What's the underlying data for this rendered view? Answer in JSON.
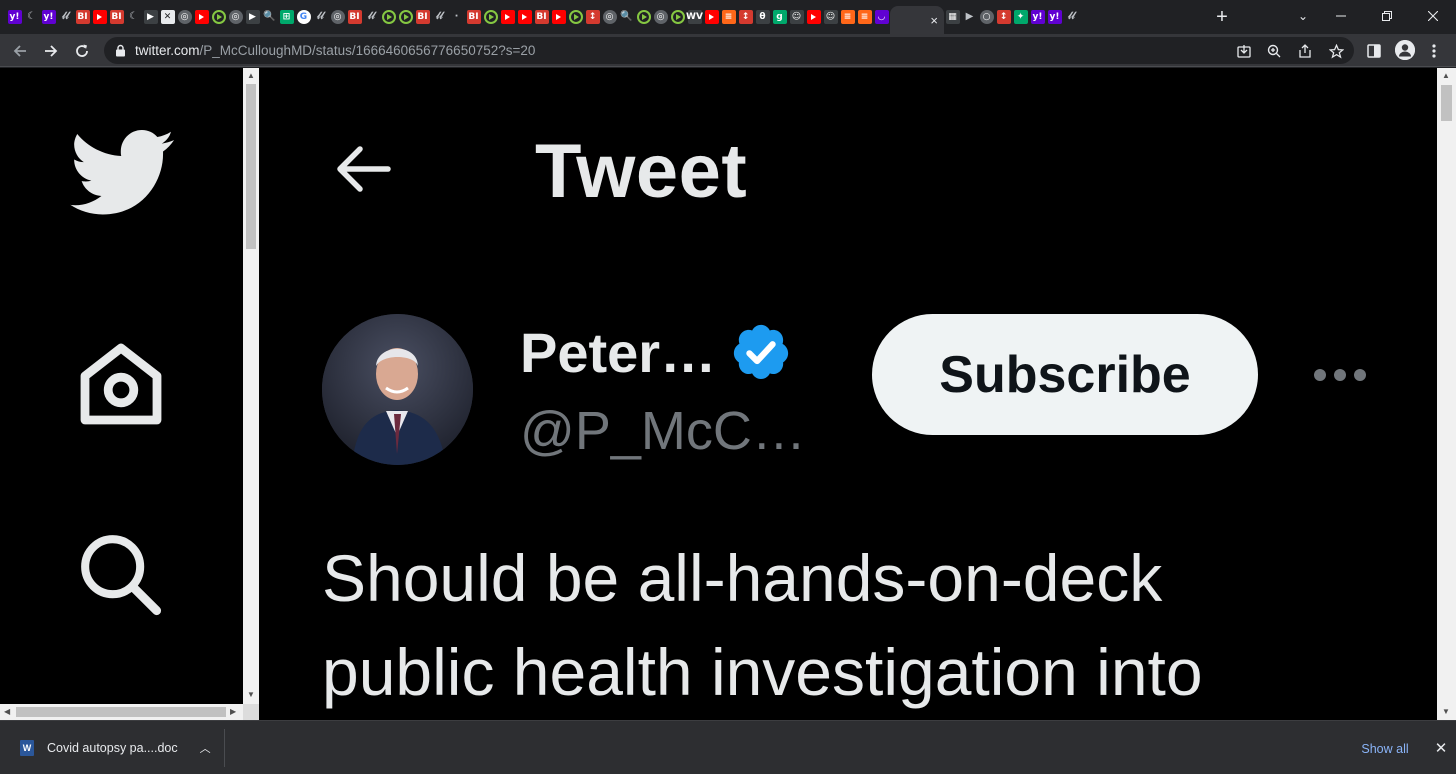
{
  "browser": {
    "tab_favicons": [
      {
        "kind": "yahoo",
        "glyph": "y!"
      },
      {
        "kind": "sub",
        "glyph": "☾"
      },
      {
        "kind": "yahoo",
        "glyph": "y!"
      },
      {
        "kind": "sub",
        "glyph": "𝓁𝓁"
      },
      {
        "kind": "bi",
        "glyph": "BI"
      },
      {
        "kind": "yt",
        "glyph": ""
      },
      {
        "kind": "bi",
        "glyph": "BI"
      },
      {
        "kind": "sub",
        "glyph": "☾"
      },
      {
        "kind": "dark",
        "glyph": "▶"
      },
      {
        "kind": "doc",
        "glyph": "✕"
      },
      {
        "kind": "globe",
        "glyph": "◎"
      },
      {
        "kind": "yt",
        "glyph": ""
      },
      {
        "kind": "rumble",
        "glyph": ""
      },
      {
        "kind": "globe",
        "glyph": "◎"
      },
      {
        "kind": "dark",
        "glyph": "▶"
      },
      {
        "kind": "sub",
        "glyph": "🔍"
      },
      {
        "kind": "green",
        "glyph": "⊞"
      },
      {
        "kind": "google",
        "glyph": "G"
      },
      {
        "kind": "sub",
        "glyph": "𝓁𝓁"
      },
      {
        "kind": "globe",
        "glyph": "◎"
      },
      {
        "kind": "bi",
        "glyph": "BI"
      },
      {
        "kind": "sub",
        "glyph": "𝓁𝓁"
      },
      {
        "kind": "rumble",
        "glyph": ""
      },
      {
        "kind": "rumble",
        "glyph": ""
      },
      {
        "kind": "bi",
        "glyph": "BI"
      },
      {
        "kind": "sub",
        "glyph": "𝓁𝓁"
      },
      {
        "kind": "sub",
        "glyph": "·"
      },
      {
        "kind": "bi",
        "glyph": "BI"
      },
      {
        "kind": "rumble",
        "glyph": ""
      },
      {
        "kind": "yt",
        "glyph": ""
      },
      {
        "kind": "yt",
        "glyph": ""
      },
      {
        "kind": "bi",
        "glyph": "BI"
      },
      {
        "kind": "yt",
        "glyph": ""
      },
      {
        "kind": "rumble",
        "glyph": ""
      },
      {
        "kind": "bi",
        "glyph": "↕"
      },
      {
        "kind": "globe",
        "glyph": "◎"
      },
      {
        "kind": "sub",
        "glyph": "🔍"
      },
      {
        "kind": "rumble",
        "glyph": ""
      },
      {
        "kind": "globe",
        "glyph": "◎"
      },
      {
        "kind": "rumble",
        "glyph": ""
      },
      {
        "kind": "dark",
        "glyph": "WV"
      },
      {
        "kind": "yt",
        "glyph": ""
      },
      {
        "kind": "ss",
        "glyph": "≡"
      },
      {
        "kind": "bi",
        "glyph": "↕"
      },
      {
        "kind": "dark",
        "glyph": "θ"
      },
      {
        "kind": "green",
        "glyph": "g"
      },
      {
        "kind": "dark",
        "glyph": "☺"
      },
      {
        "kind": "yt",
        "glyph": ""
      },
      {
        "kind": "dark",
        "glyph": "☺"
      },
      {
        "kind": "ss",
        "glyph": "≡"
      },
      {
        "kind": "ss",
        "glyph": "≡"
      },
      {
        "kind": "yahoo",
        "glyph": "◡"
      }
    ],
    "tab_favicons_after": [
      {
        "kind": "dark",
        "glyph": "▦"
      },
      {
        "kind": "sub",
        "glyph": "▶"
      },
      {
        "kind": "globe",
        "glyph": "○"
      },
      {
        "kind": "bi",
        "glyph": "↕"
      },
      {
        "kind": "green",
        "glyph": "✦"
      },
      {
        "kind": "yahoo",
        "glyph": "y!"
      },
      {
        "kind": "yahoo",
        "glyph": "y!"
      },
      {
        "kind": "sub",
        "glyph": "𝓁𝓁"
      }
    ],
    "active_tab_close": "×",
    "new_tab": "+",
    "url_host": "twitter.com",
    "url_path": "/P_McCulloughMD/status/1666460656776650752?s=20"
  },
  "twitter": {
    "header_title": "Tweet",
    "display_name": "Peter…",
    "handle": "@P_McC…",
    "subscribe_label": "Subscribe",
    "tweet_lines": [
      "Should be all-hands-on-deck",
      "public health investigation into"
    ]
  },
  "colors": {
    "verified": "#1d9bf0",
    "text": "#e7e9ea",
    "muted": "#71767b",
    "button_bg": "#eff3f4"
  },
  "download": {
    "filename": "Covid autopsy pa....doc",
    "show_all": "Show all"
  }
}
